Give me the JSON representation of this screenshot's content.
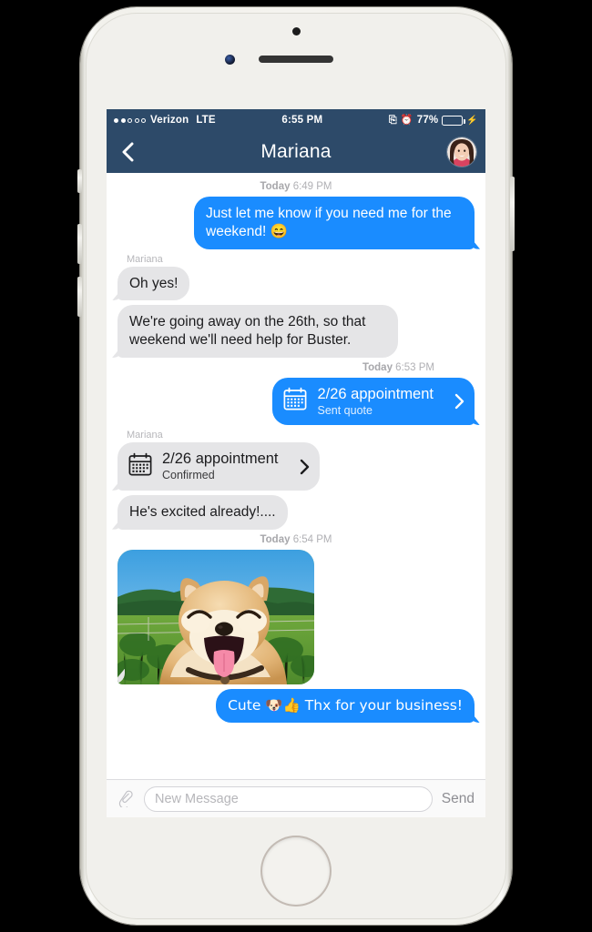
{
  "device": {
    "name": "iphone-white-silver",
    "home_button": "home-button",
    "camera": "front-camera",
    "speaker": "earpiece-speaker"
  },
  "status_bar": {
    "signal_strength_filled": 2,
    "signal_strength_total": 5,
    "carrier": "Verizon",
    "network": "LTE",
    "time": "6:55 PM",
    "lock_rotation_icon": "rotation-lock-icon",
    "alarm_icon": "alarm-clock-icon",
    "battery_percent": "77%",
    "battery_level": 77,
    "charging_icon": "charging-bolt-icon",
    "battery_color": "#4cd964"
  },
  "nav_bar": {
    "back_icon": "back-chevron-icon",
    "title": "Mariana",
    "avatar": "contact-avatar"
  },
  "theme": {
    "navbar_color": "#2d4a69",
    "outgoing_bubble_color": "#1a8cff",
    "incoming_bubble_color": "#e5e5e7",
    "screen_background": "#ffffff",
    "timestamp_color": "#b0b0b4"
  },
  "conversation": [
    {
      "kind": "timestamp",
      "align": "center",
      "day": "Today",
      "time": "6:49 PM"
    },
    {
      "kind": "text",
      "direction": "out",
      "text": "Just let me know if you need me for the weekend! 😄"
    },
    {
      "kind": "sender",
      "name": "Mariana"
    },
    {
      "kind": "text",
      "direction": "in",
      "text": "Oh yes!"
    },
    {
      "kind": "text",
      "direction": "in",
      "text": "We're going away on the 26th, so that weekend we'll need help for Buster."
    },
    {
      "kind": "timestamp",
      "align": "right",
      "day": "Today",
      "time": "6:53 PM"
    },
    {
      "kind": "card",
      "direction": "out",
      "icon": "calendar-icon",
      "title": "2/26 appointment",
      "subtitle": "Sent quote",
      "chevron": "chevron-right-icon"
    },
    {
      "kind": "sender",
      "name": "Mariana"
    },
    {
      "kind": "card",
      "direction": "in",
      "icon": "calendar-icon",
      "title": "2/26 appointment",
      "subtitle": "Confirmed",
      "chevron": "chevron-right-icon"
    },
    {
      "kind": "text",
      "direction": "in",
      "text": "He's excited already!...."
    },
    {
      "kind": "timestamp",
      "align": "center",
      "day": "Today",
      "time": "6:54 PM"
    },
    {
      "kind": "photo",
      "direction": "in",
      "alt": "smiling shiba inu dog in a grassy field"
    },
    {
      "kind": "text",
      "direction": "out",
      "text": "Cute 🐶👍 Thx for your business!"
    }
  ],
  "composer": {
    "attach_icon": "paperclip-icon",
    "input_value": "",
    "input_placeholder": "New Message",
    "send_label": "Send"
  }
}
